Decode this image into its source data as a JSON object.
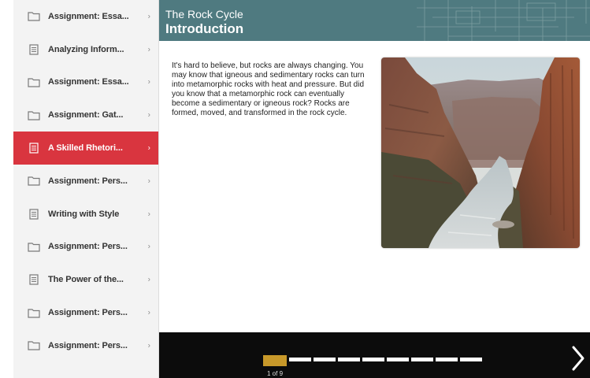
{
  "sidebar": {
    "items": [
      {
        "label": "Assignment: Essa...",
        "icon": "folder-icon",
        "active": false
      },
      {
        "label": "Analyzing Inform...",
        "icon": "document-icon",
        "active": false
      },
      {
        "label": "Assignment: Essa...",
        "icon": "folder-icon",
        "active": false
      },
      {
        "label": "Assignment: Gat...",
        "icon": "folder-icon",
        "active": false
      },
      {
        "label": "A Skilled Rhetori...",
        "icon": "document-icon",
        "active": true
      },
      {
        "label": "Assignment: Pers...",
        "icon": "folder-icon",
        "active": false
      },
      {
        "label": "Writing with Style",
        "icon": "document-icon",
        "active": false
      },
      {
        "label": "Assignment: Pers...",
        "icon": "folder-icon",
        "active": false
      },
      {
        "label": "The Power of the...",
        "icon": "document-icon",
        "active": false
      },
      {
        "label": "Assignment: Pers...",
        "icon": "folder-icon",
        "active": false
      },
      {
        "label": "Assignment: Pers...",
        "icon": "folder-icon",
        "active": false
      }
    ],
    "chevron": "›"
  },
  "header": {
    "subtitle": "The Rock Cycle",
    "title": "Introduction"
  },
  "content": {
    "text": "It's hard to believe, but rocks are always changing. You may know that igneous and sedimentary rocks can turn into metamorphic rocks with heat and pressure. But did you know that a metamorphic rock can eventually become a sedimentary or igneous rock? Rocks are formed, moved, and transformed in the rock cycle.",
    "image": "canyon-river-photo"
  },
  "footer": {
    "current_page": 1,
    "total_pages": 9,
    "page_label": "1 of 9",
    "next_icon": "chevron-right-icon"
  },
  "colors": {
    "header": "#4f7a80",
    "active_item": "#d9353f",
    "progress_current": "#c8992a",
    "footer": "#0c0c0c"
  }
}
